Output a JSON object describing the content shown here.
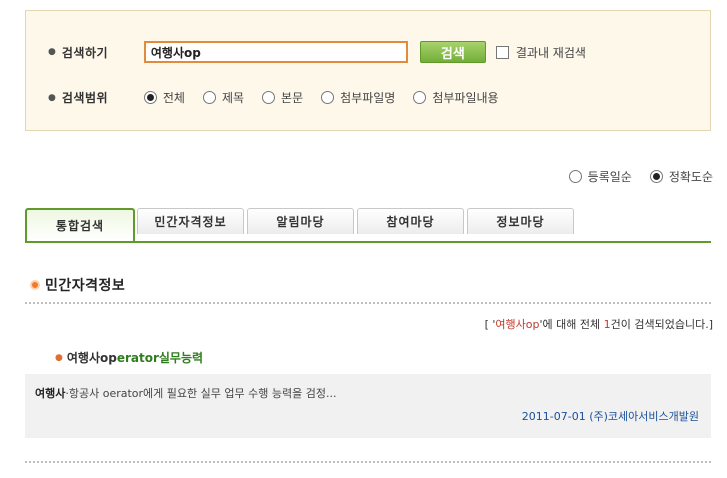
{
  "search": {
    "label": "검색하기",
    "query": "여행사op",
    "button_label": "검색",
    "research_label": "결과내 재검색"
  },
  "scope": {
    "label": "검색범위",
    "options": [
      {
        "label": "전체",
        "checked": true
      },
      {
        "label": "제목",
        "checked": false
      },
      {
        "label": "본문",
        "checked": false
      },
      {
        "label": "첨부파일명",
        "checked": false
      },
      {
        "label": "첨부파일내용",
        "checked": false
      }
    ]
  },
  "sort": {
    "options": [
      {
        "label": "등록일순",
        "checked": false
      },
      {
        "label": "정확도순",
        "checked": true
      }
    ]
  },
  "tabs": [
    {
      "label": "통합검색",
      "active": true
    },
    {
      "label": "민간자격정보",
      "active": false
    },
    {
      "label": "알림마당",
      "active": false
    },
    {
      "label": "참여마당",
      "active": false
    },
    {
      "label": "정보마당",
      "active": false
    }
  ],
  "section": {
    "title": "민간자격정보"
  },
  "summary": {
    "prefix": "[ '",
    "keyword": "여행사op",
    "middle": "'에 대해 전체 ",
    "count": "1",
    "suffix": "건이 검색되었습니다.]"
  },
  "result": {
    "title_prefix": "여행사op",
    "title_highlight": "erator실무능력",
    "desc_bold": "여행사",
    "desc_rest": "·항공사 oerator에게 필요한 실무 업무 수행 능력을 검정...",
    "date": "2011-07-01",
    "org": "(주)코세아서비스개발원"
  }
}
